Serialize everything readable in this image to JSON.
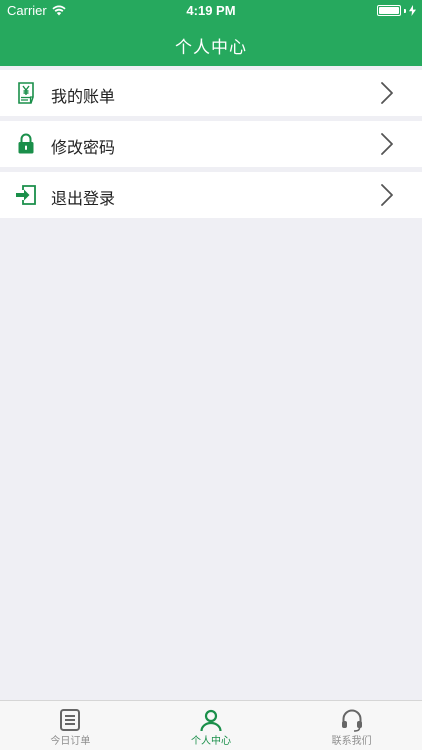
{
  "status_bar": {
    "carrier": "Carrier",
    "time": "4:19 PM"
  },
  "nav": {
    "title": "个人中心"
  },
  "menu": {
    "items": [
      {
        "label": "我的账单",
        "icon": "bill-icon"
      },
      {
        "label": "修改密码",
        "icon": "lock-icon"
      },
      {
        "label": "退出登录",
        "icon": "logout-icon"
      }
    ]
  },
  "tabs": [
    {
      "label": "今日订单",
      "icon": "orders-icon",
      "active": false
    },
    {
      "label": "个人中心",
      "icon": "person-icon",
      "active": true
    },
    {
      "label": "联系我们",
      "icon": "headset-icon",
      "active": false
    }
  ],
  "colors": {
    "brand_green": "#26a95e",
    "icon_green": "#1a8f4a",
    "background": "#efeff4",
    "tab_inactive": "#8e8e8e"
  }
}
